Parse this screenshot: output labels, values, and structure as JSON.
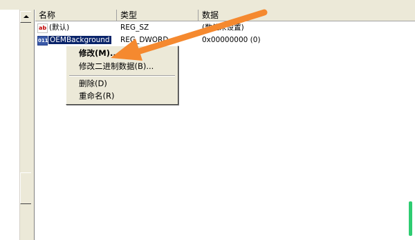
{
  "list": {
    "columns": [
      "名称",
      "类型",
      "数据"
    ],
    "rows": [
      {
        "icon": "ab",
        "name": "(默认)",
        "type": "REG_SZ",
        "data": "(数值未设置)"
      },
      {
        "icon": "bin",
        "name": "OEMBackground",
        "type": "REG_DWORD",
        "data": "0x00000000 (0)"
      }
    ]
  },
  "context_menu": {
    "items": [
      "修改(M)...",
      "修改二进制数据(B)...",
      "删除(D)",
      "重命名(R)"
    ]
  },
  "colors": {
    "arrow": "#f5892f",
    "selection": "#0a246a",
    "menu_bg": "#ece9d8",
    "scroll_indicator": "#2ecc71"
  }
}
